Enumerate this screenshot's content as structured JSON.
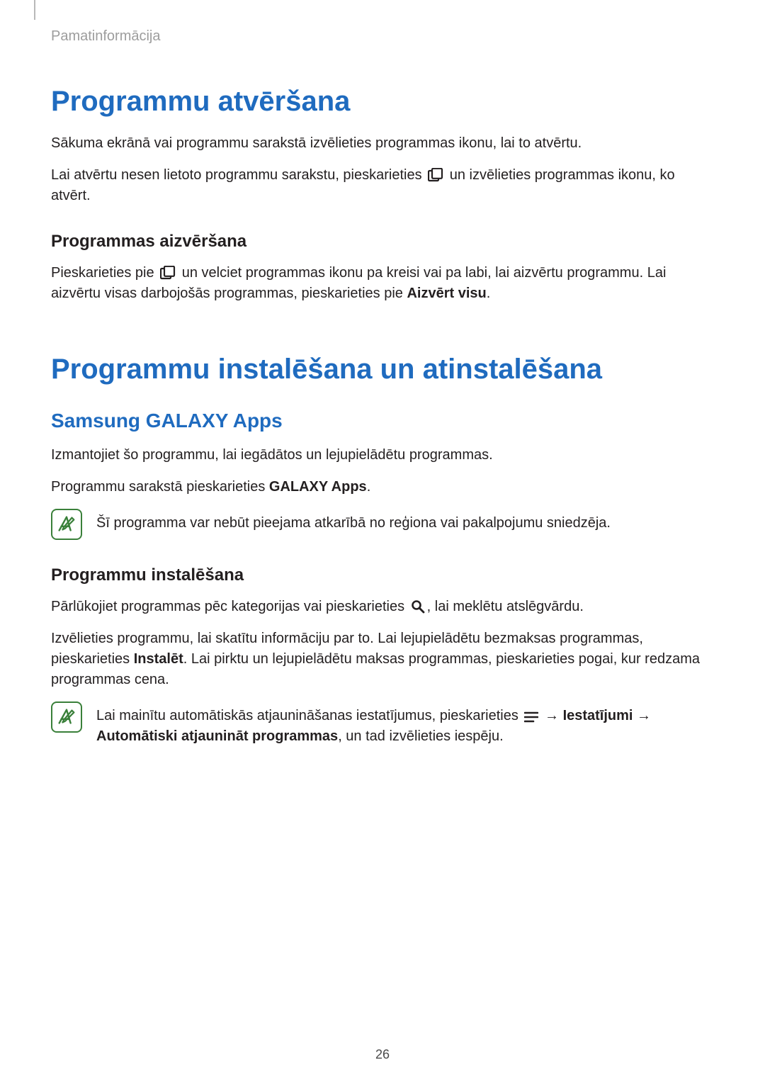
{
  "header": {
    "running": "Pamatinformācija"
  },
  "footer": {
    "page": "26"
  },
  "s1": {
    "h": "Programmu atvēršana",
    "p1": "Sākuma ekrānā vai programmu sarakstā izvēlieties programmas ikonu, lai to atvērtu.",
    "p2a": "Lai atvērtu nesen lietoto programmu sarakstu, pieskarieties ",
    "p2b": " un izvēlieties programmas ikonu, ko atvērt.",
    "h3": "Programmas aizvēršana",
    "p3a": "Pieskarieties pie ",
    "p3b": " un velciet programmas ikonu pa kreisi vai pa labi, lai aizvērtu programmu. Lai aizvērtu visas darbojošās programmas, pieskarieties pie ",
    "p3bold": "Aizvērt visu",
    "p3c": "."
  },
  "s2": {
    "h": "Programmu instalēšana un atinstalēšana",
    "h2": "Samsung GALAXY Apps",
    "p1": "Izmantojiet šo programmu, lai iegādātos un lejupielādētu programmas.",
    "p2a": "Programmu sarakstā pieskarieties ",
    "p2bold": "GALAXY Apps",
    "p2b": ".",
    "note": "Šī programma var nebūt pieejama atkarībā no reģiona vai pakalpojumu sniedzēja.",
    "h3b": "Programmu instalēšana",
    "p3a": "Pārlūkojiet programmas pēc kategorijas vai pieskarieties ",
    "p3b": ", lai meklētu atslēgvārdu.",
    "p4a": "Izvēlieties programmu, lai skatītu informāciju par to. Lai lejupielādētu bezmaksas programmas, pieskarieties ",
    "p4bold": "Instalēt",
    "p4b": ". Lai pirktu un lejupielādētu maksas programmas, pieskarieties pogai, kur redzama programmas cena.",
    "note2a": "Lai mainītu automātiskās atjaunināšanas iestatījumus, pieskarieties ",
    "note2arrow1": " → ",
    "note2bold1": "Iestatījumi",
    "note2arrow2": " → ",
    "note2bold2": "Automātiski atjaunināt programmas",
    "note2b": ", un tad izvēlieties iespēju."
  }
}
